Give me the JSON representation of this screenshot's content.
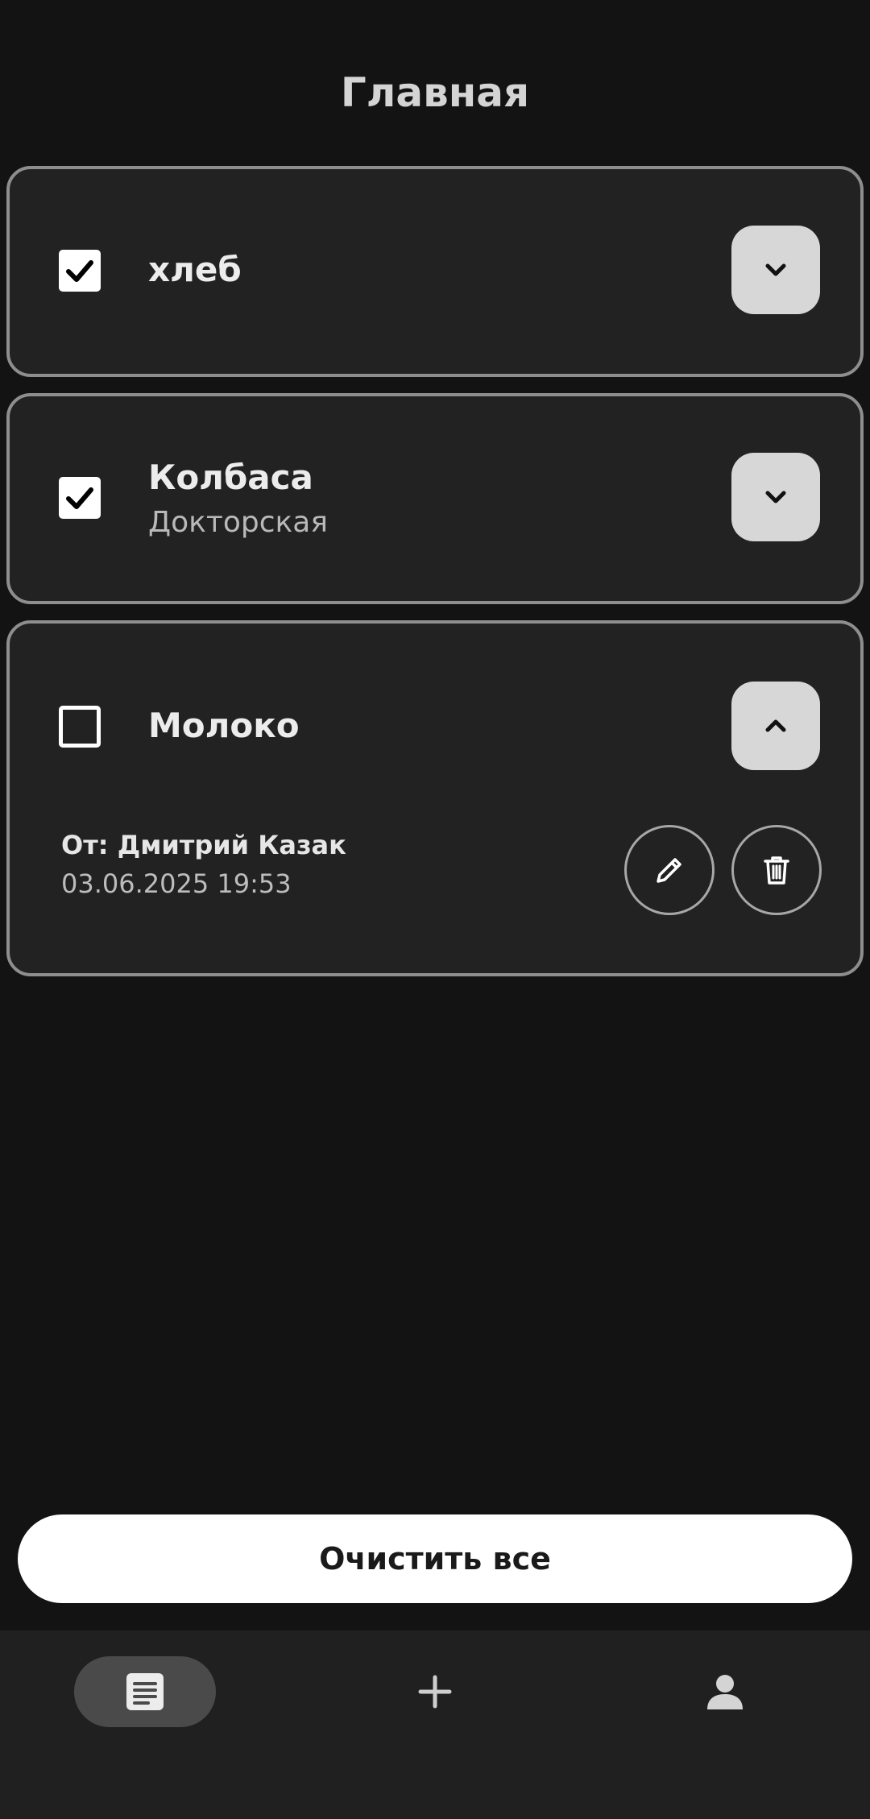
{
  "header": {
    "title": "Главная"
  },
  "items": [
    {
      "title": "хлеб",
      "subtitle": "",
      "checked": true,
      "expanded": false
    },
    {
      "title": "Колбаса",
      "subtitle": "Докторская",
      "checked": true,
      "expanded": false
    },
    {
      "title": "Молоко",
      "subtitle": "",
      "checked": false,
      "expanded": true,
      "details": {
        "from": "От: Дмитрий Казак",
        "date": "03.06.2025 19:53"
      }
    }
  ],
  "actions": {
    "clear_all": "Очистить все"
  },
  "bottom_nav": {
    "items": [
      {
        "icon": "list-icon",
        "active": true
      },
      {
        "icon": "plus-icon",
        "active": false
      },
      {
        "icon": "person-icon",
        "active": false
      }
    ]
  },
  "colors": {
    "background": "#131313",
    "card": "#222222",
    "card_border": "#8e8e8e",
    "accent_button": "#d7d7d7",
    "nav_background": "#202020",
    "nav_active": "#4a4a4a"
  }
}
